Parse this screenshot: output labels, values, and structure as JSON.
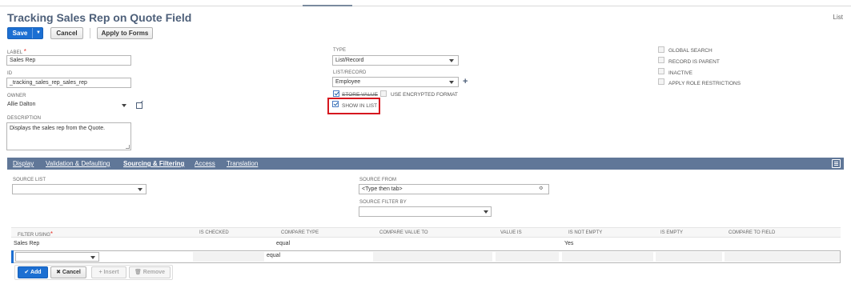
{
  "page": {
    "title": "Tracking Sales Rep on Quote Field",
    "list_link": "List"
  },
  "toolbar": {
    "save_label": "Save",
    "save_menu_icon": "▼",
    "cancel_label": "Cancel",
    "apply_label": "Apply to Forms"
  },
  "fields": {
    "label": {
      "label": "LABEL",
      "required": "*",
      "value": "Sales Rep"
    },
    "id": {
      "label": "ID",
      "value": "_tracking_sales_rep_sales_rep"
    },
    "owner": {
      "label": "OWNER",
      "value": "Allie Dalton"
    },
    "description": {
      "label": "DESCRIPTION",
      "value": "Displays the sales rep from the Quote."
    },
    "type": {
      "label": "TYPE",
      "value": "List/Record"
    },
    "list_record": {
      "label": "LIST/RECORD",
      "value": "Employee",
      "add_icon": "+"
    },
    "store_value": {
      "label": "STORE VALUE",
      "checked": true
    },
    "use_encrypted": {
      "label": "USE ENCRYPTED FORMAT",
      "checked": false
    },
    "show_in_list": {
      "label": "SHOW IN LIST",
      "checked": true
    },
    "global_search": {
      "label": "GLOBAL SEARCH",
      "checked": false
    },
    "record_is_parent": {
      "label": "RECORD IS PARENT",
      "checked": false
    },
    "inactive": {
      "label": "INACTIVE",
      "checked": false
    },
    "apply_role_restrictions": {
      "label": "APPLY ROLE RESTRICTIONS",
      "checked": false
    }
  },
  "tabs": [
    {
      "label": "Display",
      "active": false
    },
    {
      "label": "Validation & Defaulting",
      "active": false
    },
    {
      "label": "Sourcing & Filtering",
      "active": true
    },
    {
      "label": "Access",
      "active": false
    },
    {
      "label": "Translation",
      "active": false
    }
  ],
  "sourcing": {
    "source_list": {
      "label": "SOURCE LIST",
      "value": ""
    },
    "source_from": {
      "label": "SOURCE FROM",
      "value": "<Type then tab>"
    },
    "source_filter_by": {
      "label": "SOURCE FILTER BY",
      "value": ""
    }
  },
  "filter_grid": {
    "columns": [
      "FILTER USING",
      "IS CHECKED",
      "COMPARE TYPE",
      "COMPARE VALUE TO",
      "VALUE IS",
      "IS NOT EMPTY",
      "IS EMPTY",
      "COMPARE TO FIELD"
    ],
    "required_mark": "*",
    "rows": [
      [
        "Sales Rep",
        "",
        "equal",
        "",
        "",
        "Yes",
        "",
        ""
      ]
    ],
    "edit_row": {
      "compare_type": "equal"
    },
    "buttons": {
      "add": "Add",
      "add_icon": "✔",
      "cancel": "Cancel",
      "cancel_icon": "✖",
      "insert": "Insert",
      "insert_icon": "+",
      "remove": "Remove",
      "remove_icon": "🗑"
    }
  }
}
